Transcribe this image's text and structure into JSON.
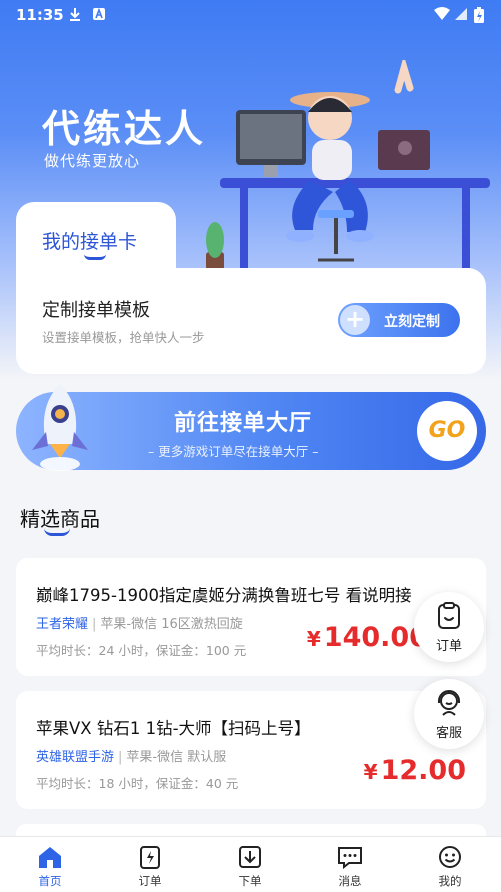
{
  "status_bar": {
    "time": "11:35"
  },
  "brand": {
    "title": "代练达人",
    "subtitle": "做代练更放心"
  },
  "order_card": {
    "tab_label": "我的接单卡",
    "template_title": "定制接单模板",
    "template_subtitle": "设置接单模板，抢单快人一步",
    "custom_button": "立刻定制"
  },
  "hall_banner": {
    "title": "前往接单大厅",
    "subtitle": "– 更多游戏订单尽在接单大厅 –",
    "go_label": "GO"
  },
  "section": {
    "title": "精选商品"
  },
  "goods": [
    {
      "title": "巅峰1795-1900指定虞姬分满换鲁班七号 看说明接",
      "game": "王者荣耀",
      "platform": "苹果-微信 16区激热回旋",
      "info": "平均时长：24 小时，保证金：100 元",
      "currency": "¥",
      "price": "140.00"
    },
    {
      "title": "苹果VX 钻石1 1钻-大师【扫码上号】",
      "game": "英雄联盟手游",
      "platform": "苹果-微信 默认服",
      "info": "平均时长：18 小时，保证金：40 元",
      "currency": "¥",
      "price": "12.00"
    }
  ],
  "float_buttons": {
    "orders": "订单",
    "service": "客服"
  },
  "tabbar": [
    {
      "label": "首页",
      "icon": "home-icon",
      "active": true
    },
    {
      "label": "订单",
      "icon": "order-icon",
      "active": false
    },
    {
      "label": "下单",
      "icon": "download-icon",
      "active": false
    },
    {
      "label": "消息",
      "icon": "message-icon",
      "active": false
    },
    {
      "label": "我的",
      "icon": "smile-icon",
      "active": false
    }
  ],
  "colors": {
    "primary": "#2f64e6",
    "price": "#e52b2b",
    "go": "#f2a21b"
  }
}
